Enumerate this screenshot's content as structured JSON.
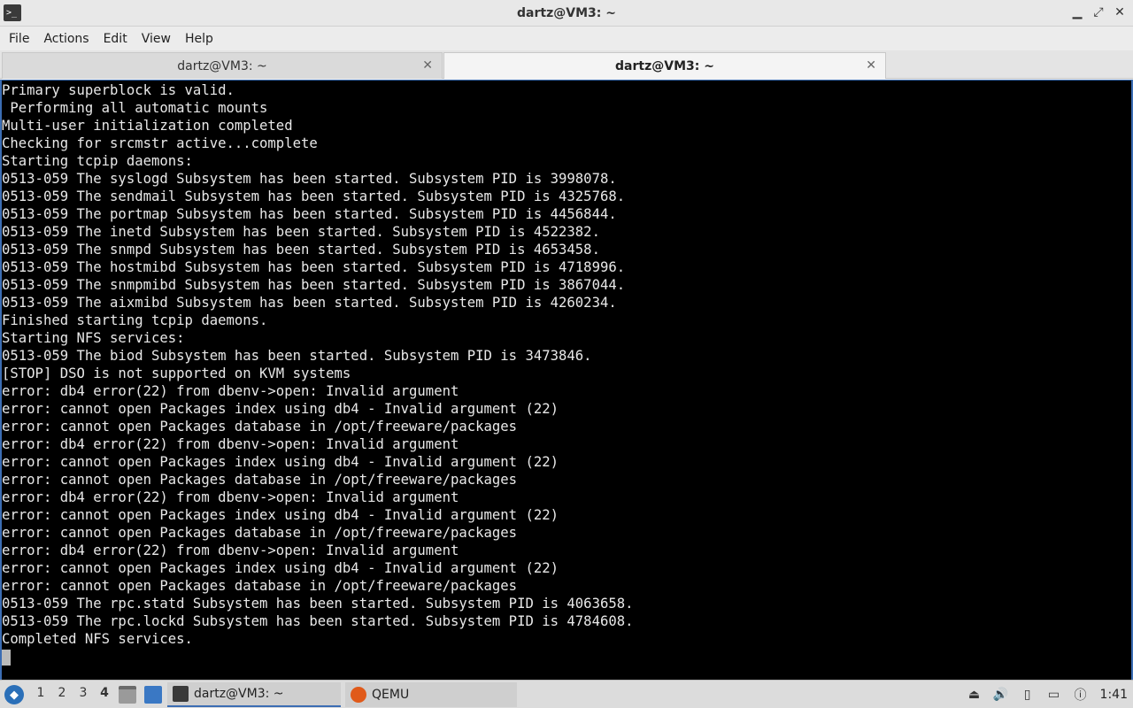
{
  "window": {
    "title": "dartz@VM3: ~",
    "icon": "terminal-icon",
    "controls": {
      "minimize": "▁",
      "maximize": "⤢",
      "close": "✕"
    }
  },
  "menu": [
    "File",
    "Actions",
    "Edit",
    "View",
    "Help"
  ],
  "tabs": [
    {
      "label": "dartz@VM3: ~",
      "active": false
    },
    {
      "label": "dartz@VM3: ~",
      "active": true
    }
  ],
  "tab_close": "✕",
  "terminal": {
    "lines": [
      "Primary superblock is valid.",
      " Performing all automatic mounts",
      "Multi-user initialization completed",
      "Checking for srcmstr active...complete",
      "Starting tcpip daemons:",
      "0513-059 The syslogd Subsystem has been started. Subsystem PID is 3998078.",
      "0513-059 The sendmail Subsystem has been started. Subsystem PID is 4325768.",
      "0513-059 The portmap Subsystem has been started. Subsystem PID is 4456844.",
      "0513-059 The inetd Subsystem has been started. Subsystem PID is 4522382.",
      "0513-059 The snmpd Subsystem has been started. Subsystem PID is 4653458.",
      "0513-059 The hostmibd Subsystem has been started. Subsystem PID is 4718996.",
      "0513-059 The snmpmibd Subsystem has been started. Subsystem PID is 3867044.",
      "0513-059 The aixmibd Subsystem has been started. Subsystem PID is 4260234.",
      "Finished starting tcpip daemons.",
      "Starting NFS services:",
      "0513-059 The biod Subsystem has been started. Subsystem PID is 3473846.",
      "[STOP] DSO is not supported on KVM systems",
      "error: db4 error(22) from dbenv->open: Invalid argument",
      "error: cannot open Packages index using db4 - Invalid argument (22)",
      "error: cannot open Packages database in /opt/freeware/packages",
      "error: db4 error(22) from dbenv->open: Invalid argument",
      "error: cannot open Packages index using db4 - Invalid argument (22)",
      "error: cannot open Packages database in /opt/freeware/packages",
      "error: db4 error(22) from dbenv->open: Invalid argument",
      "error: cannot open Packages index using db4 - Invalid argument (22)",
      "error: cannot open Packages database in /opt/freeware/packages",
      "error: db4 error(22) from dbenv->open: Invalid argument",
      "error: cannot open Packages index using db4 - Invalid argument (22)",
      "error: cannot open Packages database in /opt/freeware/packages",
      "0513-059 The rpc.statd Subsystem has been started. Subsystem PID is 4063658.",
      "0513-059 The rpc.lockd Subsystem has been started. Subsystem PID is 4784608.",
      "Completed NFS services."
    ]
  },
  "taskbar": {
    "workspaces": [
      "1",
      "2",
      "3",
      "4"
    ],
    "current_workspace": "4",
    "tasks": [
      {
        "label": "dartz@VM3: ~",
        "icon": "terminal-icon"
      },
      {
        "label": "QEMU",
        "icon": "qemu-icon"
      }
    ],
    "clock": "1:41",
    "colors": {
      "accent": "#3b6db3",
      "terminal_bg": "#000000",
      "terminal_fg": "#e8e8e8"
    }
  }
}
